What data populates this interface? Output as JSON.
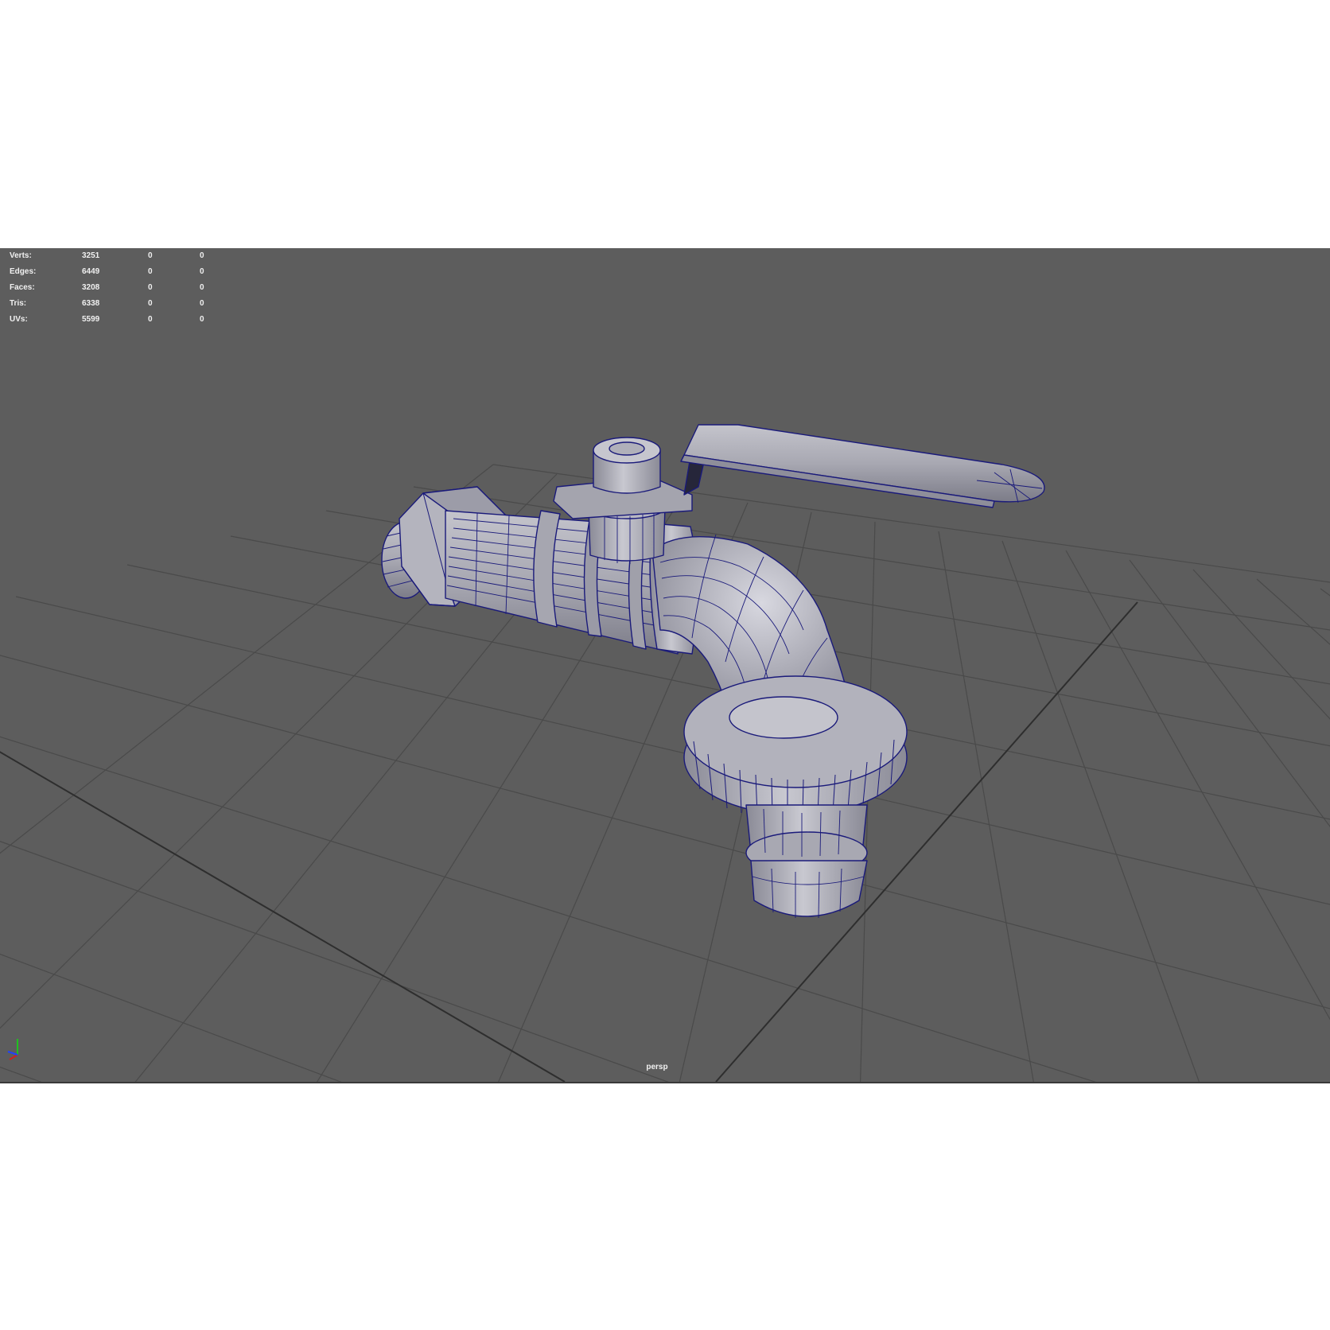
{
  "viewport": {
    "camera": "persp",
    "background_color": "#5d5d5d",
    "wireframe_color": "#1a1a7a"
  },
  "stats": [
    {
      "label": "Verts:",
      "values": [
        "3251",
        "0",
        "0"
      ]
    },
    {
      "label": "Edges:",
      "values": [
        "6449",
        "0",
        "0"
      ]
    },
    {
      "label": "Faces:",
      "values": [
        "3208",
        "0",
        "0"
      ]
    },
    {
      "label": "Tris:",
      "values": [
        "6338",
        "0",
        "0"
      ]
    },
    {
      "label": "UVs:",
      "values": [
        "5599",
        "0",
        "0"
      ]
    }
  ],
  "axis_gizmo": {
    "x_color": "#d02020",
    "y_color": "#20c020",
    "z_color": "#2040ff"
  }
}
